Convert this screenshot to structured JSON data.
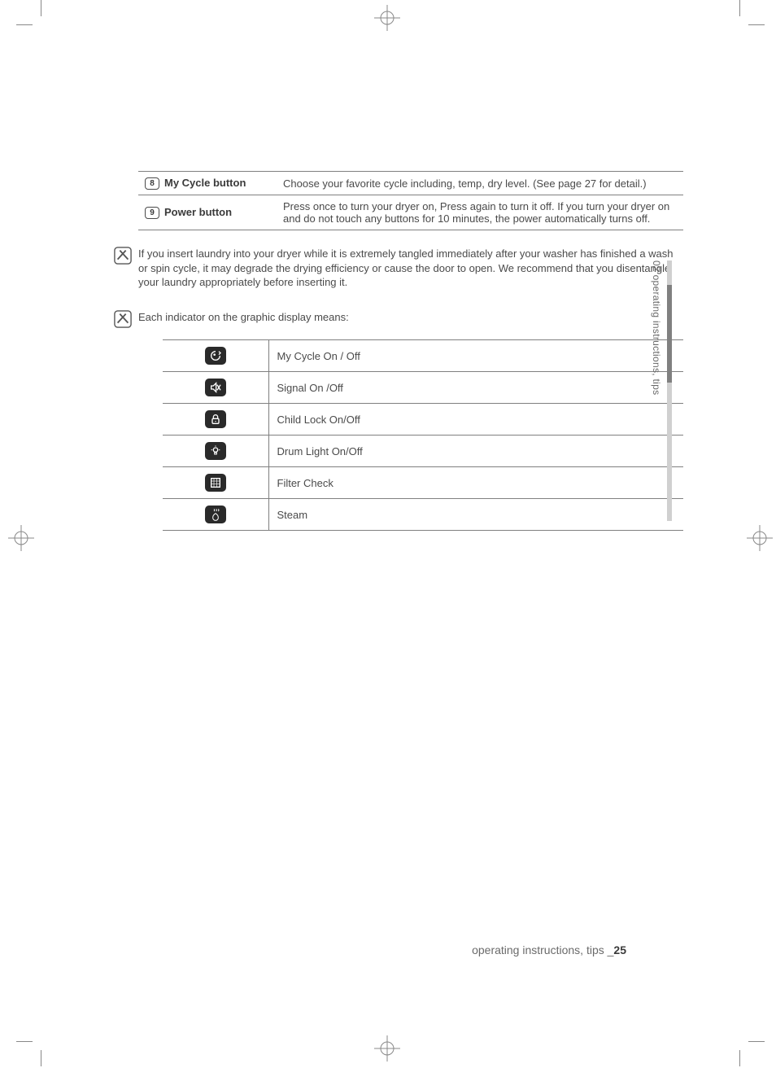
{
  "button_rows": [
    {
      "num": "8",
      "label": "My Cycle button",
      "desc": "Choose your favorite cycle including, temp, dry level. (See page 27 for detail.)"
    },
    {
      "num": "9",
      "label": "Power button",
      "desc": "Press once to turn your dryer on, Press again to turn it off. If you turn your dryer on and do not touch any buttons for 10 minutes, the power automatically turns off."
    }
  ],
  "note1": "If you insert laundry into your dryer while it is extremely tangled immediately after your washer has finished a wash or spin cycle, it may degrade the drying efficiency or cause the door to open. We recommend that you disentangle your laundry appropriately before inserting it.",
  "note2": "Each indicator on the graphic display means:",
  "indicators": [
    {
      "key": "mycycle",
      "label": "My Cycle On / Off"
    },
    {
      "key": "signal",
      "label": "Signal On /Off"
    },
    {
      "key": "childlock",
      "label": "Child Lock On/Off"
    },
    {
      "key": "drumlight",
      "label": "Drum Light On/Off"
    },
    {
      "key": "filter",
      "label": "Filter Check"
    },
    {
      "key": "steam",
      "label": "Steam"
    }
  ],
  "side_tab": "02 operating instructions, tips",
  "footer_text": "operating instructions, tips _",
  "footer_page": "25"
}
